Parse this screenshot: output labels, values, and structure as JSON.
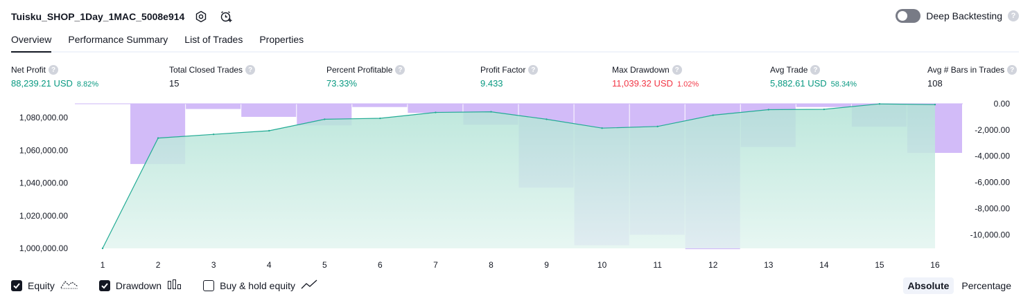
{
  "header": {
    "title": "Tuisku_SHOP_1Day_1MAC_5008e914",
    "deep_backtesting_label": "Deep Backtesting",
    "deep_backtesting_enabled": false,
    "help_glyph": "?"
  },
  "tabs": [
    {
      "label": "Overview",
      "active": true
    },
    {
      "label": "Performance Summary",
      "active": false
    },
    {
      "label": "List of Trades",
      "active": false
    },
    {
      "label": "Properties",
      "active": false
    }
  ],
  "metrics": [
    {
      "label": "Net Profit",
      "value": "88,239.21 USD",
      "sub": "8.82%",
      "tone": "pos"
    },
    {
      "label": "Total Closed Trades",
      "value": "15",
      "sub": "",
      "tone": "neutral"
    },
    {
      "label": "Percent Profitable",
      "value": "73.33%",
      "sub": "",
      "tone": "pos"
    },
    {
      "label": "Profit Factor",
      "value": "9.433",
      "sub": "",
      "tone": "pos"
    },
    {
      "label": "Max Drawdown",
      "value": "11,039.32 USD",
      "sub": "1.02%",
      "tone": "neg"
    },
    {
      "label": "Avg Trade",
      "value": "5,882.61 USD",
      "sub": "58.34%",
      "tone": "pos"
    },
    {
      "label": "Avg # Bars in Trades",
      "value": "108",
      "sub": "",
      "tone": "neutral"
    }
  ],
  "chart_data": {
    "type": "area",
    "x": [
      1,
      2,
      3,
      4,
      5,
      6,
      7,
      8,
      9,
      10,
      11,
      12,
      13,
      14,
      15,
      16
    ],
    "series": [
      {
        "name": "Equity",
        "type": "area",
        "axis": "left",
        "color": "#22ab94",
        "values": [
          1000000,
          1067500,
          1069800,
          1072000,
          1079000,
          1079600,
          1083200,
          1083600,
          1079000,
          1073600,
          1074600,
          1081500,
          1084900,
          1085100,
          1088400,
          1088000
        ]
      },
      {
        "name": "Drawdown",
        "type": "bar",
        "axis": "right",
        "color": "#cdb4f7",
        "values": [
          0,
          -4600,
          -400,
          -1000,
          -1650,
          -250,
          -700,
          -1600,
          -6400,
          -10800,
          -10000,
          -11100,
          -3300,
          -250,
          -1750,
          -3750
        ]
      }
    ],
    "y_left": {
      "ticks": [
        "1,000,000.00",
        "1,020,000.00",
        "1,040,000.00",
        "1,060,000.00",
        "1,080,000.00"
      ],
      "range": [
        1000000,
        1088500
      ]
    },
    "y_right": {
      "ticks": [
        "0.00",
        "-2,000.00",
        "-4,000.00",
        "-6,000.00",
        "-8,000.00",
        "-10,000.00"
      ],
      "range": [
        -11039.32,
        0
      ]
    },
    "grid": false
  },
  "legend": {
    "items": [
      {
        "label": "Equity",
        "checked": true,
        "icon": "equity-line-icon"
      },
      {
        "label": "Drawdown",
        "checked": true,
        "icon": "drawdown-bars-icon"
      },
      {
        "label": "Buy & hold equity",
        "checked": false,
        "icon": "buy-hold-line-icon"
      }
    ]
  },
  "modes": {
    "absolute": "Absolute",
    "percentage": "Percentage",
    "active": "Absolute"
  }
}
